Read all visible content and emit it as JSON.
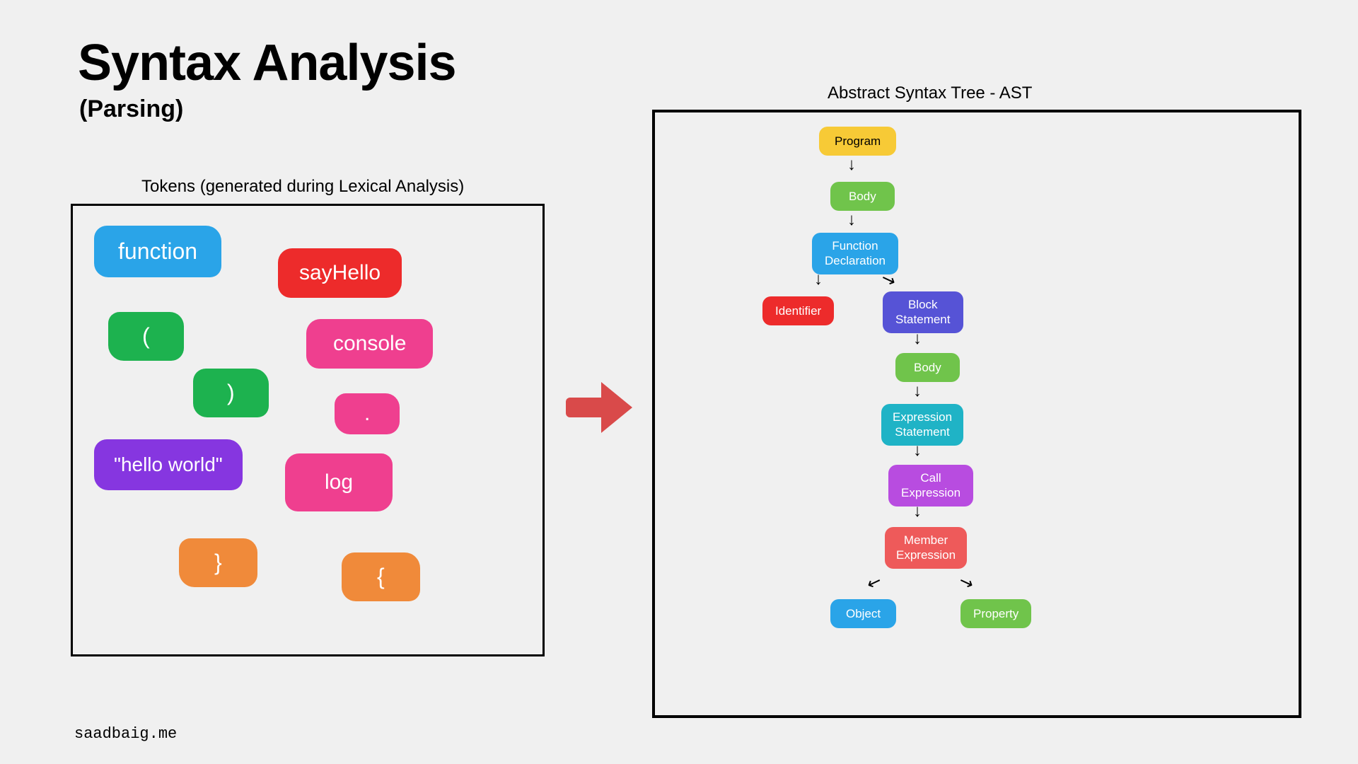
{
  "title": "Syntax Analysis",
  "subtitle": "(Parsing)",
  "tokens_label": "Tokens (generated during Lexical Analysis)",
  "ast_label": "Abstract Syntax Tree - AST",
  "tokens": {
    "function": "function",
    "sayHello": "sayHello",
    "open_paren": "(",
    "close_paren": ")",
    "console": "console",
    "dot": ".",
    "hello_world": "\"hello world\"",
    "log": "log",
    "rbrace": "}",
    "lbrace": "{"
  },
  "ast": {
    "program": "Program",
    "body1": "Body",
    "func_decl": "Function\nDeclaration",
    "identifier": "Identifier",
    "block_stmt": "Block\nStatement",
    "body2": "Body",
    "expr_stmt": "Expression\nStatement",
    "call_expr": "Call\nExpression",
    "member_expr": "Member\nExpression",
    "object": "Object",
    "property": "Property"
  },
  "arrows": {
    "down": "↓",
    "down_left": "↙",
    "down_right": "↘"
  },
  "footer": "saadbaig.me"
}
